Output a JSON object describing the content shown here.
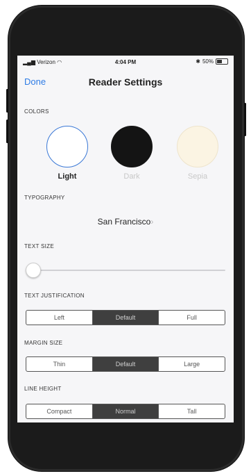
{
  "status_bar": {
    "carrier": "Verizon",
    "time": "4:04 PM",
    "battery": "50%"
  },
  "nav": {
    "done_label": "Done",
    "title": "Reader Settings"
  },
  "colors": {
    "label": "COLORS",
    "options": [
      {
        "label": "Light",
        "fill": "#ffffff",
        "border": "#3a78d6",
        "selected": true
      },
      {
        "label": "Dark",
        "fill": "#141414",
        "border": "#141414",
        "selected": false
      },
      {
        "label": "Sepia",
        "fill": "#fbf4e3",
        "border": "#eee4cc",
        "selected": false
      }
    ]
  },
  "typography": {
    "label": "TYPOGRAPHY",
    "font": "San Francisco",
    "chevron": "›"
  },
  "text_size": {
    "label": "TEXT SIZE",
    "value_fraction": 0.02
  },
  "justification": {
    "label": "TEXT JUSTIFICATION",
    "options": [
      "Left",
      "Default",
      "Full"
    ],
    "selected": 1
  },
  "margin": {
    "label": "MARGIN SIZE",
    "options": [
      "Thin",
      "Default",
      "Large"
    ],
    "selected": 1
  },
  "line_height": {
    "label": "LINE HEIGHT",
    "options": [
      "Compact",
      "Normal",
      "Tall"
    ],
    "selected": 1
  }
}
